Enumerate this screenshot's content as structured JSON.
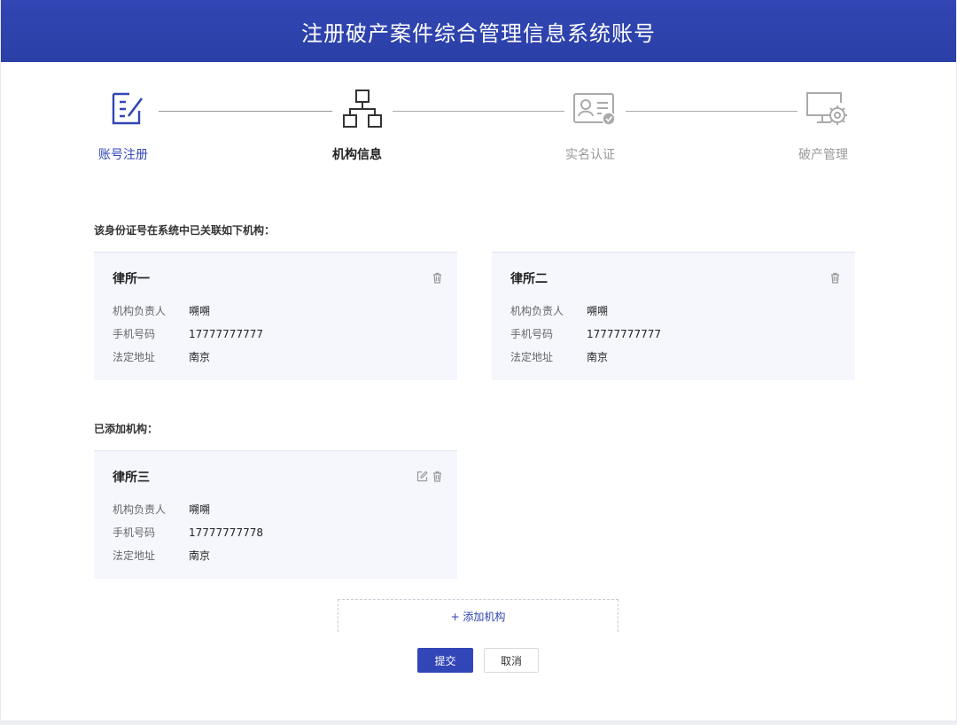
{
  "header": {
    "title": "注册破产案件综合管理信息系统账号"
  },
  "steps": [
    {
      "label": "账号注册",
      "icon": "edit-icon",
      "state": "done",
      "color": "#3346b7"
    },
    {
      "label": "机构信息",
      "icon": "org-structure-icon",
      "state": "active",
      "color": "#222222"
    },
    {
      "label": "实名认证",
      "icon": "id-card-icon",
      "state": "pending",
      "color": "#999999"
    },
    {
      "label": "破产管理",
      "icon": "monitor-settings-icon",
      "state": "pending",
      "color": "#999999"
    }
  ],
  "linked": {
    "title": "该身份证号在系统中已关联如下机构：",
    "cards": [
      {
        "name": "律所一",
        "rows": [
          {
            "label": "机构负责人",
            "value": "嗍嗍"
          },
          {
            "label": "手机号码",
            "value": "17777777777"
          },
          {
            "label": "法定地址",
            "value": "南京"
          }
        ]
      },
      {
        "name": "律所二",
        "rows": [
          {
            "label": "机构负责人",
            "value": "嗍嗍"
          },
          {
            "label": "手机号码",
            "value": "17777777777"
          },
          {
            "label": "法定地址",
            "value": "南京"
          }
        ]
      }
    ]
  },
  "added": {
    "title": "已添加机构：",
    "cards": [
      {
        "name": "律所三",
        "rows": [
          {
            "label": "机构负责人",
            "value": "嗍嗍"
          },
          {
            "label": "手机号码",
            "value": "17777777778"
          },
          {
            "label": "法定地址",
            "value": "南京"
          }
        ]
      }
    ]
  },
  "add_button": "+ 添加机构",
  "submit_label": "提交",
  "cancel_label": "取消",
  "colors": {
    "brand": "#3346b7",
    "card_bg": "#f5f7fd",
    "muted": "#999999"
  }
}
